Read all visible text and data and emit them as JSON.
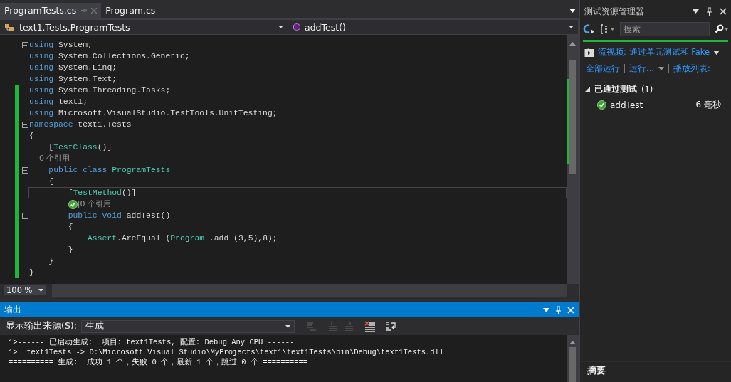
{
  "tabs": [
    {
      "label": "ProgramTests.cs",
      "selected": true
    },
    {
      "label": "Program.cs",
      "selected": false
    }
  ],
  "nav": {
    "scope": "text1.Tests.ProgramTests",
    "member": "addTest()"
  },
  "code_lines": [
    {
      "foldable": true,
      "changed": false,
      "current": false,
      "tokens": [
        {
          "text": "using",
          "kind": "keyword"
        },
        {
          "text": " System;",
          "kind": "plain"
        }
      ]
    },
    {
      "foldable": false,
      "changed": false,
      "current": false,
      "tokens": [
        {
          "text": "using",
          "kind": "keyword"
        },
        {
          "text": " System.Collections.Generic;",
          "kind": "plain"
        }
      ]
    },
    {
      "foldable": false,
      "changed": false,
      "current": false,
      "tokens": [
        {
          "text": "using",
          "kind": "keyword"
        },
        {
          "text": " System.Linq;",
          "kind": "plain"
        }
      ]
    },
    {
      "foldable": false,
      "changed": false,
      "current": false,
      "tokens": [
        {
          "text": "using",
          "kind": "keyword"
        },
        {
          "text": " System.Text;",
          "kind": "plain"
        }
      ]
    },
    {
      "foldable": false,
      "changed": true,
      "current": false,
      "tokens": [
        {
          "text": "using",
          "kind": "keyword"
        },
        {
          "text": " System.Threading.Tasks;",
          "kind": "plain"
        }
      ]
    },
    {
      "foldable": false,
      "changed": true,
      "current": false,
      "tokens": [
        {
          "text": "using",
          "kind": "keyword"
        },
        {
          "text": " text1;",
          "kind": "plain"
        }
      ]
    },
    {
      "foldable": false,
      "changed": true,
      "current": false,
      "tokens": [
        {
          "text": "using",
          "kind": "keyword"
        },
        {
          "text": " Microsoft.VisualStudio.TestTools.UnitTesting;",
          "kind": "plain"
        }
      ]
    },
    {
      "foldable": true,
      "changed": true,
      "current": false,
      "tokens": [
        {
          "text": "namespace",
          "kind": "keyword"
        },
        {
          "text": " text1.Tests",
          "kind": "plain"
        }
      ]
    },
    {
      "foldable": false,
      "changed": true,
      "current": false,
      "tokens": [
        {
          "text": "{",
          "kind": "plain"
        }
      ]
    },
    {
      "foldable": false,
      "changed": true,
      "current": false,
      "tokens": [
        {
          "text": "    [",
          "kind": "plain"
        },
        {
          "text": "TestClass",
          "kind": "type"
        },
        {
          "text": "()]",
          "kind": "plain"
        }
      ]
    },
    {
      "foldable": false,
      "changed": true,
      "current": false,
      "tokens": [
        {
          "text": "    0 个引用",
          "kind": "lens"
        }
      ]
    },
    {
      "foldable": true,
      "changed": true,
      "current": false,
      "tokens": [
        {
          "text": "    public class ",
          "kind": "keyword"
        },
        {
          "text": "ProgramTests",
          "kind": "type"
        }
      ]
    },
    {
      "foldable": false,
      "changed": true,
      "current": false,
      "tokens": [
        {
          "text": "    {",
          "kind": "plain"
        }
      ]
    },
    {
      "foldable": false,
      "changed": true,
      "current": true,
      "tokens": [
        {
          "text": "        [",
          "kind": "plain"
        },
        {
          "text": "TestMethod",
          "kind": "type"
        },
        {
          "text": "()]",
          "kind": "plain"
        }
      ]
    },
    {
      "foldable": false,
      "changed": true,
      "current": false,
      "tokens": [
        {
          "kind": "status",
          "passed": true
        },
        {
          "text": "|0 个引用",
          "kind": "lens"
        }
      ]
    },
    {
      "foldable": true,
      "changed": true,
      "current": false,
      "tokens": [
        {
          "text": "        public void",
          "kind": "keyword"
        },
        {
          "text": " addTest()",
          "kind": "plain"
        }
      ]
    },
    {
      "foldable": false,
      "changed": true,
      "current": false,
      "tokens": [
        {
          "text": "        {",
          "kind": "plain"
        }
      ]
    },
    {
      "foldable": false,
      "changed": true,
      "current": false,
      "tokens": [
        {
          "text": "            Assert",
          "kind": "type"
        },
        {
          "text": ".AreEqual (",
          "kind": "plain"
        },
        {
          "text": "Program",
          "kind": "type"
        },
        {
          "text": " .add (3,5),8);",
          "kind": "plain"
        }
      ]
    },
    {
      "foldable": false,
      "changed": true,
      "current": false,
      "tokens": [
        {
          "text": "        }",
          "kind": "plain"
        }
      ]
    },
    {
      "foldable": false,
      "changed": true,
      "current": false,
      "tokens": [
        {
          "text": "    }",
          "kind": "plain"
        }
      ]
    },
    {
      "foldable": false,
      "changed": true,
      "current": false,
      "tokens": [
        {
          "text": "}",
          "kind": "plain"
        }
      ]
    }
  ],
  "zoom": "100 %",
  "output": {
    "title": "输出",
    "source_label": "显示输出来源(S):",
    "source_value": "生成",
    "lines": [
      "1>------ 已启动生成:  项目: text1Tests, 配置: Debug Any CPU ------",
      "1>  text1Tests -> D:\\Microsoft Visual Studio\\MyProjects\\text1\\text1Tests\\bin\\Debug\\text1Tests.dll",
      "========== 生成:  成功 1 个，失败 0 个，最新 1 个，跳过 0 个 =========="
    ]
  },
  "test_explorer": {
    "title": "测试资源管理器",
    "search_placeholder": "搜索",
    "banner": "流视频: 通过单元测试和 Fake",
    "actions": [
      "全部运行",
      "运行...",
      "播放列表:"
    ],
    "groups": [
      {
        "label": "已通过测试",
        "count": "(1)",
        "expanded": true,
        "children": [
          {
            "name": "addTest",
            "duration": "6 毫秒",
            "passed": true
          }
        ]
      }
    ],
    "summary": "摘要"
  }
}
